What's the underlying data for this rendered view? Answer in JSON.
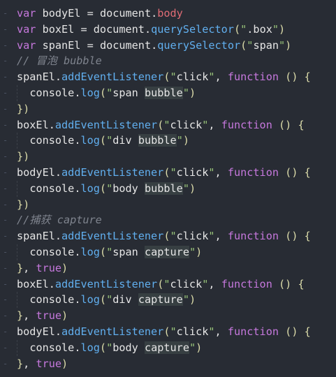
{
  "editor": {
    "lines": [
      "var bodyEl = document.body",
      "var boxEl = document.querySelector(\".box\")",
      "var spanEl = document.querySelector(\"span\")",
      "// 冒泡 bubble",
      "spanEl.addEventListener(\"click\", function () {",
      "  console.log(\"span bubble\")",
      "})",
      "boxEl.addEventListener(\"click\", function () {",
      "  console.log(\"div bubble\")",
      "})",
      "bodyEl.addEventListener(\"click\", function () {",
      "  console.log(\"body bubble\")",
      "})",
      "//捕获 capture",
      "spanEl.addEventListener(\"click\", function () {",
      "  console.log(\"span capture\")",
      "}, true)",
      "boxEl.addEventListener(\"click\", function () {",
      "  console.log(\"div capture\")",
      "}, true)",
      "bodyEl.addEventListener(\"click\", function () {",
      "  console.log(\"body capture\")",
      "}, true)"
    ]
  }
}
